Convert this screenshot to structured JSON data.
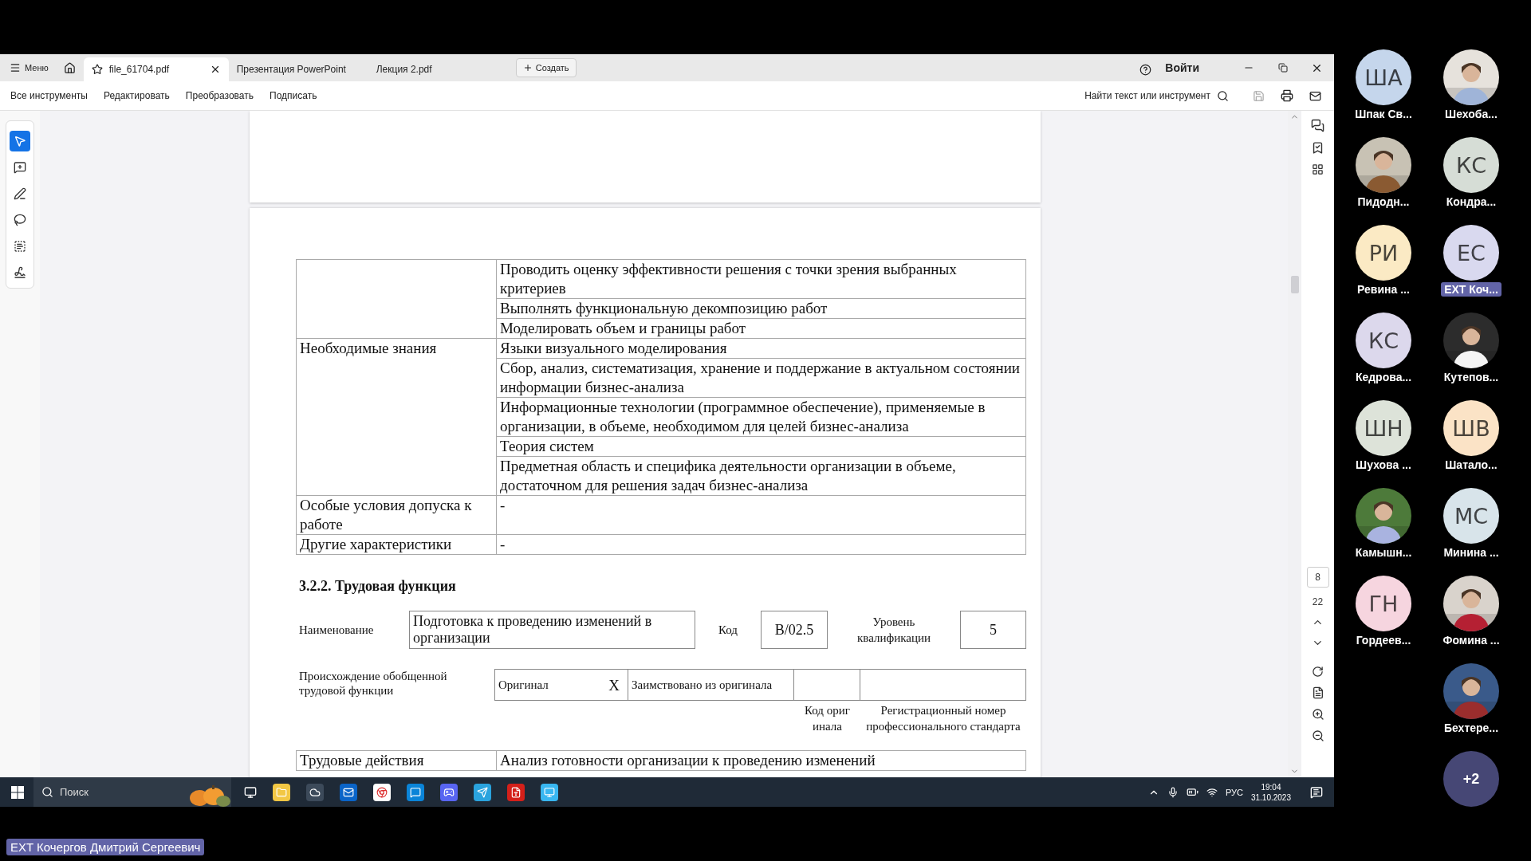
{
  "app": {
    "menu_label": "Меню",
    "tabs": [
      {
        "label": "file_61704.pdf",
        "selected": true
      },
      {
        "label": "Презентация PowerPoint",
        "selected": false
      },
      {
        "label": "Лекция 2.pdf",
        "selected": false
      }
    ],
    "create_label": "Создать",
    "sign_in": "Войти",
    "toolbar_items": [
      "Все инструменты",
      "Редактировать",
      "Преобразовать",
      "Подписать"
    ],
    "search_hint": "Найти текст или инструмент",
    "tools": [
      {
        "kind": "select",
        "selected": true
      },
      {
        "kind": "comment",
        "selected": false
      },
      {
        "kind": "draw",
        "selected": false
      },
      {
        "kind": "lasso",
        "selected": false
      },
      {
        "kind": "text",
        "selected": false
      },
      {
        "kind": "sign",
        "selected": false
      }
    ],
    "page_current": "8",
    "page_total": "22"
  },
  "document": {
    "table": [
      {
        "items": [
          "Проводить оценку эффективности решения с точки зрения выбранных критериев",
          "Выполнять функциональную декомпозицию работ",
          "Моделировать объем и границы работ"
        ]
      },
      {
        "label": "Необходимые знания",
        "items": [
          "Языки визуального моделирования",
          "Сбор, анализ, систематизация, хранение и поддержание в актуальном состоянии информации бизнес-анализа",
          "Информационные технологии (программное обеспечение), применяемые в организации, в объеме, необходимом для целей бизнес-анализа",
          "Теория систем",
          "Предметная область и специфика деятельности организации в объеме, достаточном для решения задач бизнес-анализа"
        ]
      },
      {
        "label": "Особые условия допуска к работе",
        "items": [
          "-"
        ]
      },
      {
        "label": "Другие характеристики",
        "items": [
          "-"
        ]
      }
    ],
    "section_title": "3.2.2. Трудовая функция",
    "function": {
      "name_label": "Наименование",
      "name": "Подготовка к проведению изменений в организации",
      "code_label": "Код",
      "code": "В/02.5",
      "level_label": "Уровень квалификации",
      "level_value": "5"
    },
    "origin": {
      "label": "Происхождение обобщенной трудовой функции",
      "original_label": "Оригинал",
      "original_mark": "X",
      "borrowed_label": "Заимствовано из оригинала",
      "code_caption": "Код оригинала",
      "reg_caption": "Регистрационный номер профессионального стандарта"
    },
    "next_row": {
      "label": "Трудовые действия",
      "value": "Анализ готовности организации к проведению изменений"
    }
  },
  "taskbar": {
    "search_placeholder": "Поиск",
    "language": "РУС",
    "time": "19:04",
    "date": "31.10.2023"
  },
  "speaker_tag": "EXT Кочергов Дмитрий Сергеевич",
  "participant_columns": [
    [
      {
        "name": "Шпак Св...",
        "kind": "initials",
        "initials": "ША",
        "color": "#c5d6ec",
        "highlighted": false
      },
      {
        "name": "Пидодн...",
        "kind": "picture",
        "highlighted": false
      },
      {
        "name": "Ревина ...",
        "kind": "initials",
        "initials": "РИ",
        "color": "#fbeac4",
        "highlighted": false
      },
      {
        "name": "Кедрова...",
        "kind": "initials",
        "initials": "КС",
        "color": "#dcd8ec",
        "highlighted": false
      },
      {
        "name": "Шухова ...",
        "kind": "initials",
        "initials": "ШН",
        "color": "#dde3d9",
        "highlighted": false
      },
      {
        "name": "Камышн...",
        "kind": "picture",
        "highlighted": false
      },
      {
        "name": "Гордеев...",
        "kind": "initials",
        "initials": "ГН",
        "color": "#f6d5df",
        "highlighted": false
      }
    ],
    [
      {
        "name": "Шехоба...",
        "kind": "picture",
        "highlighted": false
      },
      {
        "name": "Кондра...",
        "kind": "initials",
        "initials": "КС",
        "color": "#d6ddd6",
        "highlighted": false
      },
      {
        "name": "EXT Коч...",
        "kind": "initials",
        "initials": "ЕС",
        "color": "#d9d9ef",
        "highlighted": true
      },
      {
        "name": "Кутепов...",
        "kind": "picture",
        "highlighted": false
      },
      {
        "name": "Шатало...",
        "kind": "initials",
        "initials": "ШВ",
        "color": "#fbe3c6",
        "highlighted": false
      },
      {
        "name": "Минина ...",
        "kind": "initials",
        "initials": "МС",
        "color": "#d8e4ea",
        "highlighted": false
      },
      {
        "name": "Фомина ...",
        "kind": "picture",
        "highlighted": false
      },
      {
        "name": "Бехтере...",
        "kind": "picture",
        "highlighted": false
      }
    ]
  ],
  "overflow_count": "+2"
}
